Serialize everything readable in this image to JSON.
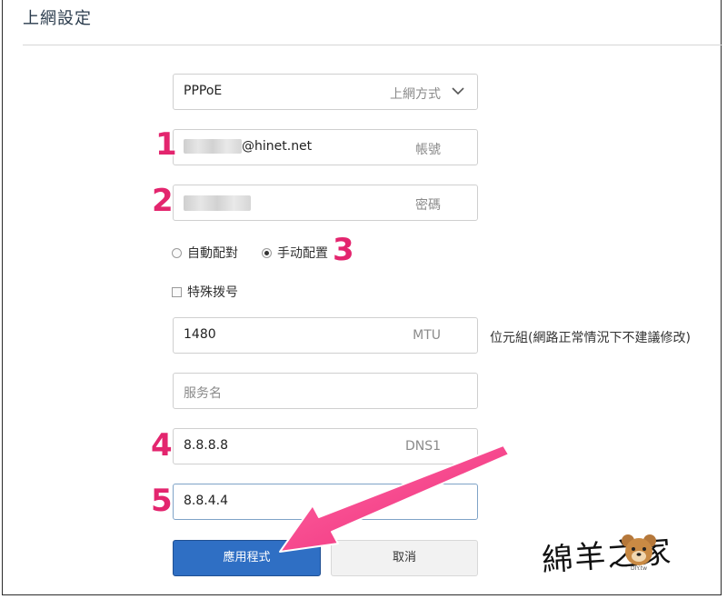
{
  "page": {
    "title": "上網設定"
  },
  "connection": {
    "value": "PPPoE",
    "hint": "上網方式"
  },
  "account": {
    "suffix": "@hinet.net",
    "hint": "帳號"
  },
  "password": {
    "hint": "密碼"
  },
  "dns_mode": {
    "options": [
      {
        "label": "自動配對",
        "selected": false
      },
      {
        "label": "手动配置",
        "selected": true
      }
    ]
  },
  "special_dial": {
    "label": "特殊拨号",
    "checked": false
  },
  "mtu": {
    "value": "1480",
    "hint": "MTU",
    "note": "位元組(網路正常情況下不建議修改)"
  },
  "service_name": {
    "placeholder": "服务名"
  },
  "dns1": {
    "value": "8.8.8.8",
    "hint": "DNS1"
  },
  "dns2": {
    "value": "8.8.4.4"
  },
  "buttons": {
    "apply": "應用程式",
    "cancel": "取消"
  },
  "annotations": {
    "n1": "1",
    "n2": "2",
    "n3": "3",
    "n4": "4",
    "n5": "5"
  },
  "watermark": {
    "text": "綿羊之家",
    "sub": "DIY.tw"
  },
  "colors": {
    "accent": "#2f6fc4",
    "annotation": "#e3256e",
    "arrow": "#f53f85"
  }
}
